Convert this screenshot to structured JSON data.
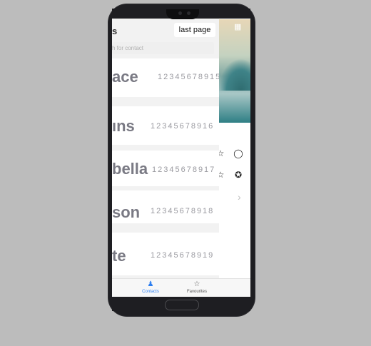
{
  "header": {
    "title_fragment": "s",
    "last_page_label": "last page"
  },
  "search": {
    "placeholder": "h for contact"
  },
  "contacts": [
    {
      "name": "ace",
      "phone": "12345678915"
    },
    {
      "name": "ıns",
      "phone": "12345678916"
    },
    {
      "name": "bella",
      "phone": "12345678917"
    },
    {
      "name": "son",
      "phone": "12345678918"
    },
    {
      "name": "te",
      "phone": "12345678919"
    }
  ],
  "tabs": [
    {
      "label": "Contacts",
      "icon": "contacts-icon",
      "active": true
    },
    {
      "label": "Favourites",
      "icon": "star-icon",
      "active": false
    }
  ],
  "colors": {
    "accent": "#2d7ff0",
    "background": "#bcbcbc",
    "phone_body": "#1e1e22"
  }
}
